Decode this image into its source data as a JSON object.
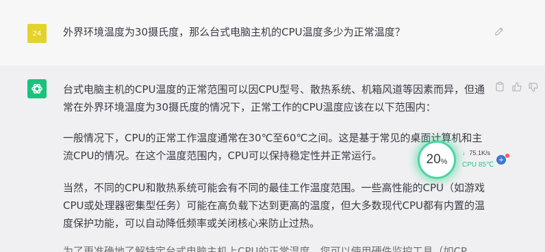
{
  "user": {
    "avatar_label": "24",
    "question": "外界环境温度为30摄氏度，那么台式电脑主机的CPU温度多少为正常温度？"
  },
  "assistant": {
    "paragraphs": [
      "台式电脑主机的CPU温度的正常范围可以因CPU型号、散热系统、机箱风道等因素而异，但通常在外界环境温度为30摄氏度的情况下，正常工作的CPU温度应该在以下范围内：",
      "一般情况下，CPU的正常工作温度通常在30℃至60℃之间。这是基于常见的桌面计算机和主流CPU的情况。在这个温度范围内，CPU可以保持稳定性并正常运行。",
      "当然，不同的CPU和散热系统可能会有不同的最佳工作温度范围。一些高性能的CPU（如游戏CPU或处理器密集型任务）可能在高负载下达到更高的温度，但大多数现代CPU都有内置的温度保护功能，可以自动降低频率或关闭核心来防止过热。",
      "为了更准确地了解特定台式电脑主机上CPU的正常温度，您可以使用硬件监控工具（如CP"
    ]
  },
  "monitor": {
    "load_value": "20",
    "load_unit": "%",
    "net_arrow": "↓",
    "net_speed": "75.1K/s",
    "cpu_label": "CPU 85℃",
    "plus": "+"
  },
  "colors": {
    "user_avatar": "#e3d32a",
    "bot_avatar": "#19c37d",
    "gauge_ring": "#48d7a0",
    "cpu_temp": "#2fbf87"
  }
}
